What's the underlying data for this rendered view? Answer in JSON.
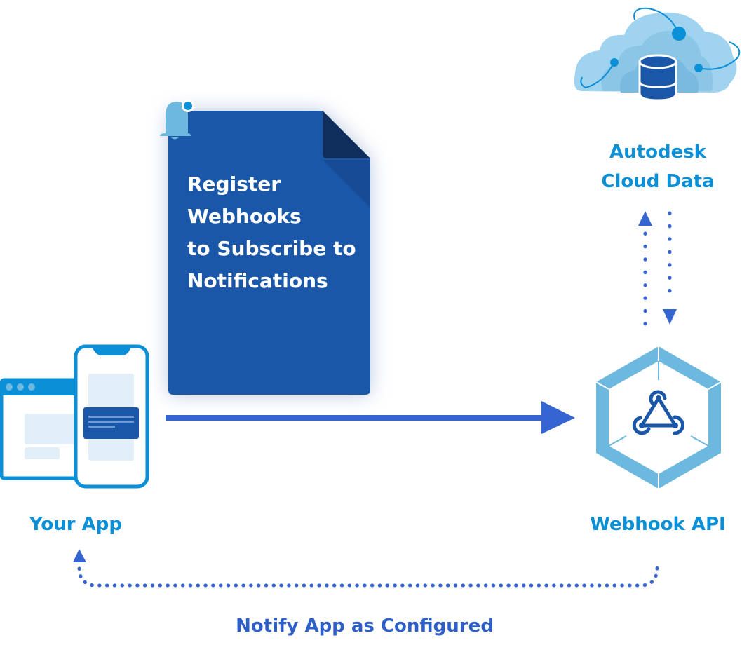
{
  "document": {
    "lines": [
      "Register",
      "Webhooks",
      "to Subscribe to",
      "Notifications"
    ],
    "icon": "bell-icon"
  },
  "nodes": {
    "cloud": {
      "label_line1": "Autodesk",
      "label_line2": "Cloud Data",
      "icon": "cloud-database-icon"
    },
    "app": {
      "label": "Your App",
      "icon": "app-devices-icon"
    },
    "webhook": {
      "label": "Webhook API",
      "icon": "webhook-hexagon-icon"
    }
  },
  "edges": {
    "notify_label": "Notify App as Configured"
  },
  "colors": {
    "doc_blue": "#1a57a8",
    "doc_fold": "#0f2e5c",
    "light_blue": "#6cb8de",
    "label_blue": "#0b8fd6",
    "arrow_blue": "#3565d0"
  }
}
